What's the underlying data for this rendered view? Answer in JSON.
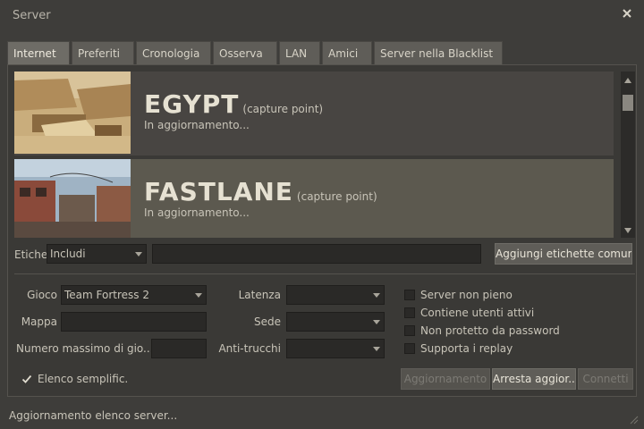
{
  "window": {
    "title": "Server",
    "close_icon": "close-icon"
  },
  "tabs": [
    {
      "label": "Internet",
      "active": true
    },
    {
      "label": "Preferiti"
    },
    {
      "label": "Cronologia"
    },
    {
      "label": "Osserva"
    },
    {
      "label": "LAN"
    },
    {
      "label": "Amici"
    },
    {
      "label": "Server nella Blacklist"
    }
  ],
  "servers": [
    {
      "map": "EGYPT",
      "mode": "(capture point)",
      "status": "In aggiornamento..."
    },
    {
      "map": "FASTLANE",
      "mode": "(capture point)",
      "status": "In aggiornamento..."
    }
  ],
  "tags": {
    "label": "Etichette",
    "mode_value": "Includi",
    "input_value": "",
    "add_button": "Aggiungi etichette comun."
  },
  "filters": {
    "game_label": "Gioco",
    "game_value": "Team Fortress 2",
    "map_label": "Mappa",
    "map_value": "",
    "max_players_label": "Numero massimo di gio..",
    "max_players_value": "",
    "latency_label": "Latenza",
    "latency_value": "",
    "location_label": "Sede",
    "location_value": "",
    "anticheat_label": "Anti-trucchi",
    "anticheat_value": ""
  },
  "checkboxes": [
    {
      "label": "Server non pieno",
      "checked": false
    },
    {
      "label": "Contiene utenti attivi",
      "checked": false
    },
    {
      "label": "Non protetto da password",
      "checked": false
    },
    {
      "label": "Supporta i replay",
      "checked": false
    }
  ],
  "simplified_list": {
    "label": "Elenco semplific.",
    "checked": true
  },
  "buttons": {
    "refresh": "Aggiornamento",
    "stop_refresh": "Arresta aggior...",
    "connect": "Connetti"
  },
  "status": "Aggiornamento elenco server...",
  "colors": {
    "background": "#3e3d3a",
    "row_selected": "#5c594f",
    "row": "#484542",
    "text": "#c8c4b8",
    "map_title": "#e6e1d2"
  }
}
